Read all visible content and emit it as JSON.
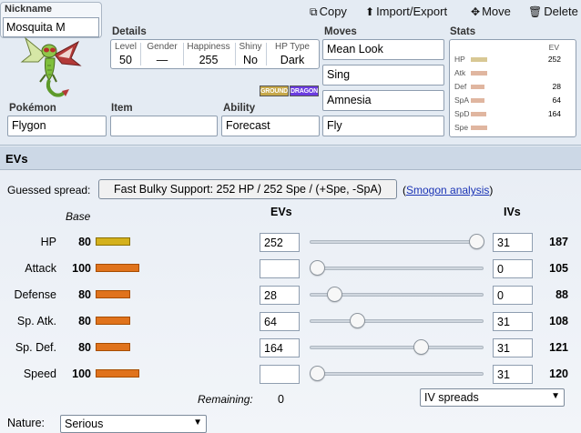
{
  "nickname": {
    "label": "Nickname",
    "value": "Mosquita M"
  },
  "toolbar": {
    "copy": "Copy",
    "import_export": "Import/Export",
    "move": "Move",
    "delete": "Delete"
  },
  "sprite": {
    "icon": "flygon-sprite"
  },
  "details": {
    "label": "Details",
    "level_h": "Level",
    "level": "50",
    "gender_h": "Gender",
    "gender": "—",
    "happiness_h": "Happiness",
    "happiness": "255",
    "shiny_h": "Shiny",
    "shiny": "No",
    "hptype_h": "HP Type",
    "hptype": "Dark"
  },
  "types": [
    {
      "name": "GROUND",
      "color": "#c6a84a"
    },
    {
      "name": "DRAGON",
      "color": "#6b3ce0"
    }
  ],
  "pokemon": {
    "label": "Pokémon",
    "value": "Flygon"
  },
  "item": {
    "label": "Item",
    "value": ""
  },
  "ability": {
    "label": "Ability",
    "value": "Forecast"
  },
  "moves": {
    "label": "Moves",
    "list": [
      "Mean Look",
      "Sing",
      "Amnesia",
      "Fly"
    ]
  },
  "stats_panel": {
    "label": "Stats",
    "ev_header": "EV",
    "rows": [
      {
        "name": "HP",
        "ev": "252",
        "bar": 0.55,
        "color": "#d8c894"
      },
      {
        "name": "Atk",
        "ev": "",
        "bar": 0.55,
        "color": "#e0b6a0"
      },
      {
        "name": "Def",
        "ev": "28",
        "bar": 0.48,
        "color": "#e0b6a0"
      },
      {
        "name": "SpA",
        "ev": "64",
        "bar": 0.48,
        "color": "#e0b6a0"
      },
      {
        "name": "SpD",
        "ev": "164",
        "bar": 0.52,
        "color": "#e0b6a0"
      },
      {
        "name": "Spe",
        "ev": "",
        "bar": 0.55,
        "color": "#e0b6a0"
      }
    ]
  },
  "evs_section": {
    "title": "EVs",
    "guessed_label": "Guessed spread:",
    "guessed_value": "Fast Bulky Support: 252 HP / 252 Spe / (+Spe, -SpA)",
    "smogon_open": "(",
    "smogon_link": "Smogon analysis",
    "smogon_close": ")",
    "base_header": "Base",
    "evs_header": "EVs",
    "ivs_header": "IVs",
    "rows": [
      {
        "name": "HP",
        "base": "80",
        "base_num": 80,
        "ev": "252",
        "ev_num": 252,
        "iv": "31",
        "final": "187",
        "bar_color": "#d4b11c"
      },
      {
        "name": "Attack",
        "base": "100",
        "base_num": 100,
        "ev": "",
        "ev_num": 0,
        "iv": "0",
        "final": "105",
        "bar_color": "#e0731c"
      },
      {
        "name": "Defense",
        "base": "80",
        "base_num": 80,
        "ev": "28",
        "ev_num": 28,
        "iv": "0",
        "final": "88",
        "bar_color": "#e0731c"
      },
      {
        "name": "Sp. Atk.",
        "base": "80",
        "base_num": 80,
        "ev": "64",
        "ev_num": 64,
        "iv": "31",
        "final": "108",
        "bar_color": "#e0731c"
      },
      {
        "name": "Sp. Def.",
        "base": "80",
        "base_num": 80,
        "ev": "164",
        "ev_num": 164,
        "iv": "31",
        "final": "121",
        "bar_color": "#e0731c"
      },
      {
        "name": "Speed",
        "base": "100",
        "base_num": 100,
        "ev": "",
        "ev_num": 0,
        "iv": "31",
        "final": "120",
        "bar_color": "#e0731c"
      }
    ],
    "remaining_label": "Remaining:",
    "remaining_value": "0",
    "iv_spreads": "IV spreads",
    "nature_label": "Nature:",
    "nature_value": "Serious"
  }
}
